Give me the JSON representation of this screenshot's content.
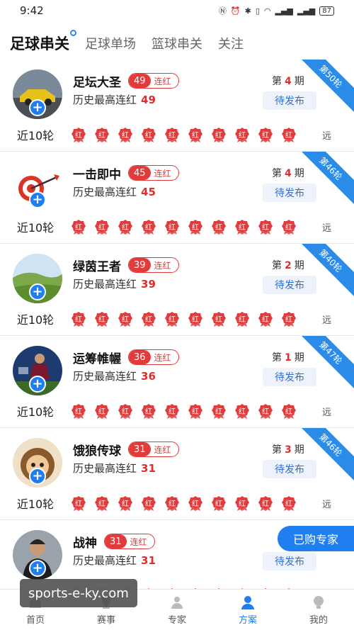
{
  "status": {
    "time": "9:42",
    "battery": "87"
  },
  "tabs": [
    {
      "label": "足球串关",
      "active": true
    },
    {
      "label": "足球单场",
      "active": false
    },
    {
      "label": "篮球串关",
      "active": false
    },
    {
      "label": "关注",
      "active": false
    }
  ],
  "labels": {
    "history": "历史最高连红",
    "recent": "近10轮",
    "far": "远",
    "period_prefix": "第",
    "period_suffix": "期",
    "pending": "待发布",
    "streak": "连红",
    "badge": "红"
  },
  "experts": [
    {
      "name": "足坛大圣",
      "streak": "49",
      "history": "49",
      "period": "4",
      "ribbon": "第50轮",
      "avatar": "car"
    },
    {
      "name": "一击即中",
      "streak": "45",
      "history": "45",
      "period": "4",
      "ribbon": "第46轮",
      "avatar": "target"
    },
    {
      "name": "绿茵王者",
      "streak": "39",
      "history": "39",
      "period": "2",
      "ribbon": "第40轮",
      "avatar": "landscape"
    },
    {
      "name": "运筹帷幄",
      "streak": "36",
      "history": "36",
      "period": "1",
      "ribbon": "第47轮",
      "avatar": "player"
    },
    {
      "name": "饿狼传球",
      "streak": "31",
      "history": "31",
      "period": "3",
      "ribbon": "第46轮",
      "avatar": "cartoon"
    },
    {
      "name": "战神",
      "streak": "31",
      "history": "31",
      "period": "",
      "ribbon": "",
      "avatar": "man"
    }
  ],
  "bought_button": "已购专家",
  "watermark": "sports-e-ky.com",
  "nav": [
    {
      "label": "首页",
      "icon": "home-icon",
      "active": false
    },
    {
      "label": "赛事",
      "icon": "trophy-icon",
      "active": false
    },
    {
      "label": "专家",
      "icon": "expert-icon",
      "active": false
    },
    {
      "label": "方案",
      "icon": "plan-icon",
      "active": true
    },
    {
      "label": "我的",
      "icon": "profile-icon",
      "active": false
    }
  ],
  "colors": {
    "accent": "#1f7ff0",
    "red": "#e23b3b",
    "ribbon": "#2b8be8"
  }
}
